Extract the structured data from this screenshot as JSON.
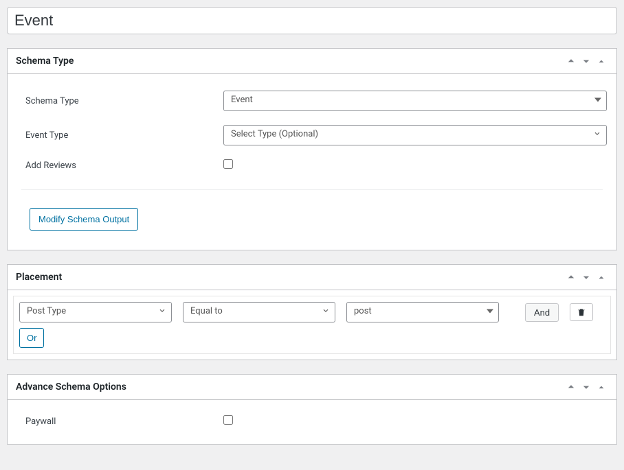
{
  "title": "Event",
  "panels": {
    "schema_type": {
      "title": "Schema Type",
      "fields": {
        "schema_type_label": "Schema Type",
        "schema_type_value": "Event",
        "event_type_label": "Event Type",
        "event_type_value": "Select Type (Optional)",
        "add_reviews_label": "Add Reviews"
      },
      "modify_btn": "Modify Schema Output"
    },
    "placement": {
      "title": "Placement",
      "row": {
        "sel1": "Post Type",
        "sel2": "Equal to",
        "sel3": "post",
        "and": "And",
        "or": "Or"
      }
    },
    "advance": {
      "title": "Advance Schema Options",
      "fields": {
        "paywall_label": "Paywall"
      }
    }
  }
}
